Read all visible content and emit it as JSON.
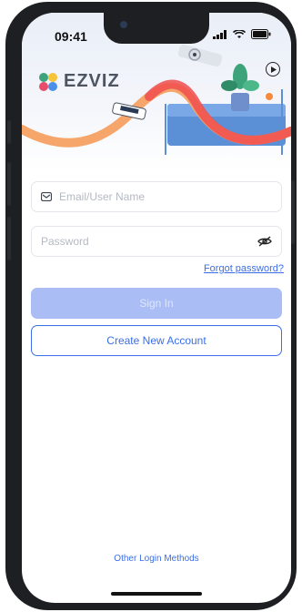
{
  "status_bar": {
    "time": "09:41"
  },
  "brand": {
    "name": "EZVIZ"
  },
  "login": {
    "email_placeholder": "Email/User Name",
    "password_placeholder": "Password",
    "forgot_label": "Forgot password?",
    "signin_label": "Sign In",
    "create_label": "Create New Account",
    "other_label": "Other Login Methods"
  },
  "colors": {
    "accent": "#3a6ee8",
    "signin_disabled": "#aabdf5",
    "wave_orange": "#f6a56b",
    "wave_red": "#f04e4e",
    "sofa_blue": "#5b8fd6"
  }
}
